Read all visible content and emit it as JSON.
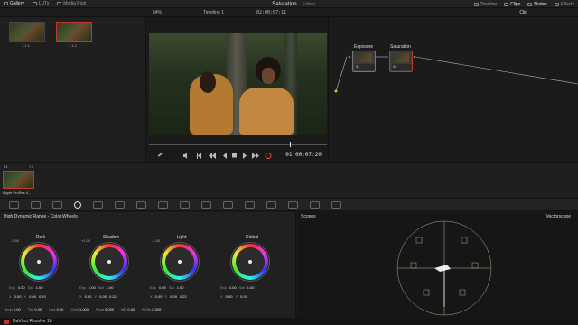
{
  "topbar": {
    "items": [
      {
        "label": "Gallery",
        "icon": "gallery-icon",
        "active": true
      },
      {
        "label": "LUTs",
        "icon": "luts-icon",
        "active": false
      },
      {
        "label": "Media Pool",
        "icon": "media-pool-icon",
        "active": false
      }
    ],
    "project_title": "Saturation",
    "project_status": "Edited",
    "right_items": [
      {
        "label": "Timeline",
        "icon": "timeline-icon",
        "active": false
      },
      {
        "label": "Clips",
        "icon": "clips-icon",
        "active": true
      },
      {
        "label": "Nodes",
        "icon": "nodes-icon",
        "active": true
      },
      {
        "label": "Effects",
        "icon": "effects-icon",
        "active": false
      }
    ]
  },
  "viewer": {
    "zoom": "54%",
    "timeline_name": "Timeline 1",
    "header_timecode": "02:00:07:11",
    "timecode": "01:00:07:20"
  },
  "gallery": {
    "stills": [
      {
        "label": "1.1.1",
        "selected": false
      },
      {
        "label": "1.1.2",
        "selected": true
      }
    ]
  },
  "nodes_panel": {
    "mode": "Clip",
    "nodes": [
      {
        "label": "Exposure",
        "num": "01"
      },
      {
        "label": "Saturation",
        "num": "02"
      }
    ]
  },
  "timeline": {
    "clip_index": "01",
    "clip_track": "V1",
    "clip_name": "Apple ProRes 4..."
  },
  "color_panel": {
    "title": "High Dynamic Range - Color Wheels",
    "wheels": [
      {
        "name": "Dark",
        "tag": "-1.50",
        "exp": "0.00",
        "sat": "1.00",
        "x": "0.00",
        "y": "0.00",
        "l": "0.20"
      },
      {
        "name": "Shadow",
        "tag": "+1.00",
        "exp": "0.00",
        "sat": "1.00",
        "x": "0.00",
        "y": "0.00",
        "l": "0.22"
      },
      {
        "name": "Light",
        "tag": "-1.00",
        "exp": "0.00",
        "sat": "1.00",
        "x": "0.00",
        "y": "0.00",
        "l": "0.22"
      },
      {
        "name": "Global",
        "tag": "",
        "exp": "0.00",
        "sat": "1.00",
        "x": "0.00",
        "y": "0.00",
        "l": ""
      }
    ],
    "bottom": [
      {
        "label": "Temp",
        "value": "0.00"
      },
      {
        "label": "Tint",
        "value": "0.00"
      },
      {
        "label": "Hue",
        "value": "0.00"
      },
      {
        "label": "Cont",
        "value": "1.000"
      },
      {
        "label": "Pivot",
        "value": "0.000"
      },
      {
        "label": "MD",
        "value": "0.00"
      },
      {
        "label": "B/Ofs",
        "value": "0.000"
      }
    ]
  },
  "scopes": {
    "title": "Scopes",
    "mode": "Vectorscope"
  },
  "status": {
    "app": "DaVinci Resolve 18"
  },
  "colors": {
    "accent_red": "#c0392b",
    "panel": "#202020",
    "scope_graticule": "#cfcf9a"
  }
}
